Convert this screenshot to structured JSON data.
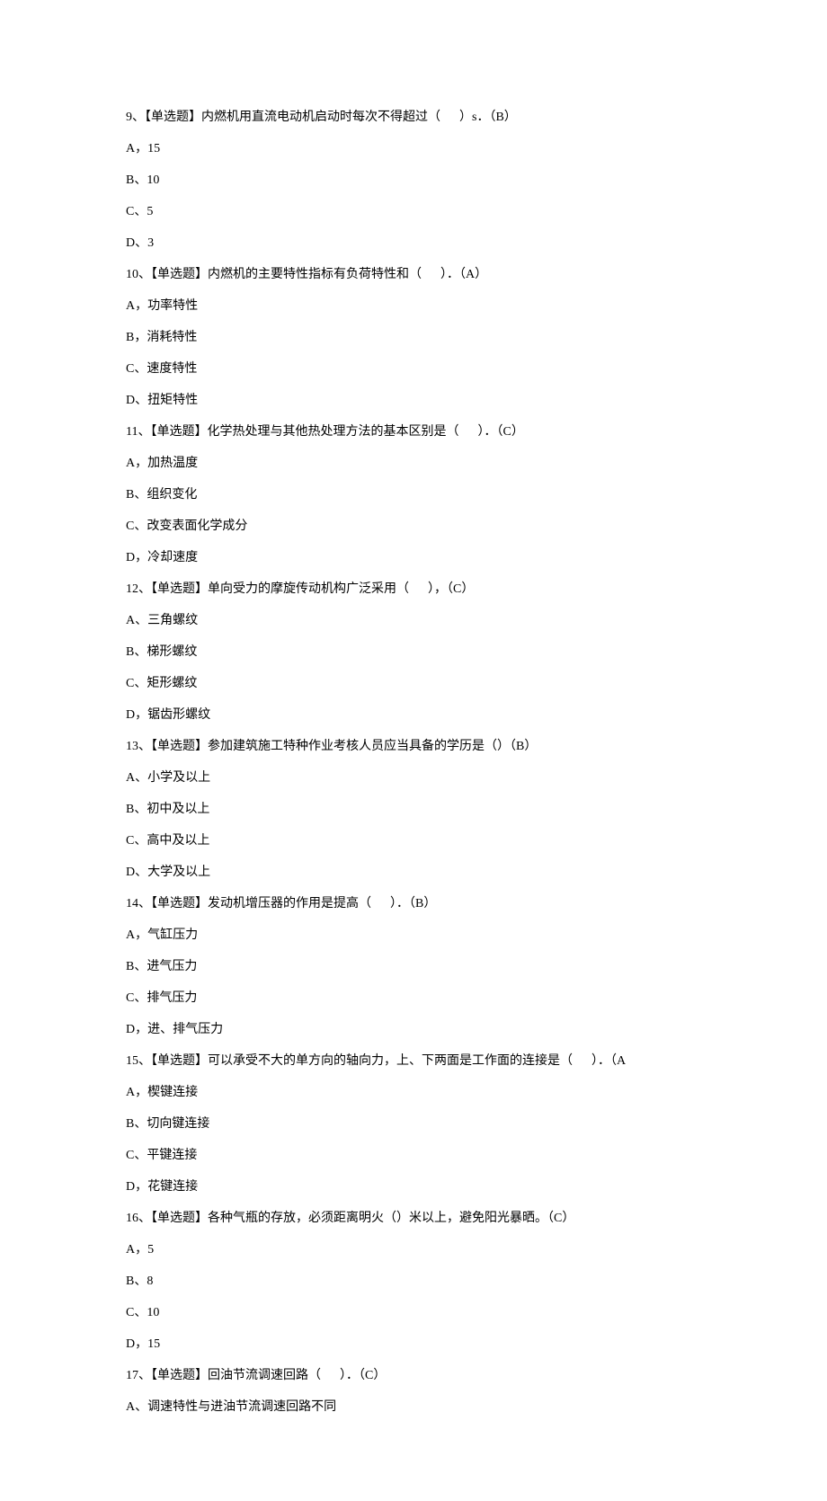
{
  "questions": [
    {
      "number": "9",
      "type": "【单选题】",
      "text_before": "内燃机用直流电动机启动时每次不得超过（",
      "text_after": "）s．（B）",
      "options": [
        {
          "letter": "A",
          "sep": "，",
          "text": "15"
        },
        {
          "letter": "B",
          "sep": "、",
          "text": "10"
        },
        {
          "letter": "C",
          "sep": "、",
          "text": "5"
        },
        {
          "letter": "D",
          "sep": "、",
          "text": "3"
        }
      ]
    },
    {
      "number": "10",
      "type": "【单选题】",
      "text_before": "内燃机的主要特性指标有负荷特性和（",
      "text_after": "）．（A）",
      "options": [
        {
          "letter": "A",
          "sep": "，",
          "text": "功率特性"
        },
        {
          "letter": "B",
          "sep": "，",
          "text": "消耗特性"
        },
        {
          "letter": "C",
          "sep": "、",
          "text": "速度特性"
        },
        {
          "letter": "D",
          "sep": "、",
          "text": "扭矩特性"
        }
      ]
    },
    {
      "number": "11",
      "type": "【单选题】",
      "text_before": "化学热处理与其他热处理方法的基本区别是（",
      "text_after": "）．（C）",
      "options": [
        {
          "letter": "A",
          "sep": "，",
          "text": "加热温度"
        },
        {
          "letter": "B",
          "sep": "、",
          "text": "组织变化"
        },
        {
          "letter": "C",
          "sep": "、",
          "text": "改变表面化学成分"
        },
        {
          "letter": "D",
          "sep": "，",
          "text": "冷却速度"
        }
      ]
    },
    {
      "number": "12",
      "type": "【单选题】",
      "text_before": "单向受力的摩旋传动机构广泛采用（",
      "text_after": "），（C）",
      "options": [
        {
          "letter": "A",
          "sep": "、",
          "text": "三角螺纹"
        },
        {
          "letter": "B",
          "sep": "、",
          "text": "梯形螺纹"
        },
        {
          "letter": "C",
          "sep": "、",
          "text": "矩形螺纹"
        },
        {
          "letter": "D",
          "sep": "，",
          "text": "锯齿形螺纹"
        }
      ]
    },
    {
      "number": "13",
      "type": "【单选题】",
      "text_before": "参加建筑施工特种作业考核人员应当具备的学历是（）",
      "text_after": "（B）",
      "options": [
        {
          "letter": "A",
          "sep": "、",
          "text": "小学及以上"
        },
        {
          "letter": "B",
          "sep": "、",
          "text": "初中及以上"
        },
        {
          "letter": "C",
          "sep": "、",
          "text": "高中及以上"
        },
        {
          "letter": "D",
          "sep": "、",
          "text": "大学及以上"
        }
      ]
    },
    {
      "number": "14",
      "type": "【单选题】",
      "text_before": "发动机增压器的作用是提高（",
      "text_after": "）．（B）",
      "options": [
        {
          "letter": "A",
          "sep": "，",
          "text": "气缸压力"
        },
        {
          "letter": "B",
          "sep": "、",
          "text": "进气压力"
        },
        {
          "letter": "C",
          "sep": "、",
          "text": "排气压力"
        },
        {
          "letter": "D",
          "sep": "，",
          "text": "进、排气压力"
        }
      ]
    },
    {
      "number": "15",
      "type": "【单选题】",
      "text_before": "可以承受不大的单方向的轴向力，上、下两面是工作面的连接是（",
      "text_after": "）．（A",
      "options": [
        {
          "letter": "A",
          "sep": "，",
          "text": "楔键连接"
        },
        {
          "letter": "B",
          "sep": "、",
          "text": "切向键连接"
        },
        {
          "letter": "C",
          "sep": "、",
          "text": "平键连接"
        },
        {
          "letter": "D",
          "sep": "，",
          "text": "花键连接"
        }
      ]
    },
    {
      "number": "16",
      "type": "【单选题】",
      "text_before": "各种气瓶的存放，必须距离明火（）米以上，避免阳光暴晒。",
      "text_after": "（C）",
      "options": [
        {
          "letter": "A",
          "sep": "，",
          "text": "5"
        },
        {
          "letter": "B",
          "sep": "、",
          "text": "8"
        },
        {
          "letter": "C",
          "sep": "、",
          "text": "10"
        },
        {
          "letter": "D",
          "sep": "，",
          "text": "15"
        }
      ]
    },
    {
      "number": "17",
      "type": "【单选题】",
      "text_before": "回油节流调速回路（",
      "text_after": "）．（C）",
      "options": [
        {
          "letter": "A",
          "sep": "、",
          "text": "调速特性与进油节流调速回路不同"
        }
      ]
    }
  ]
}
